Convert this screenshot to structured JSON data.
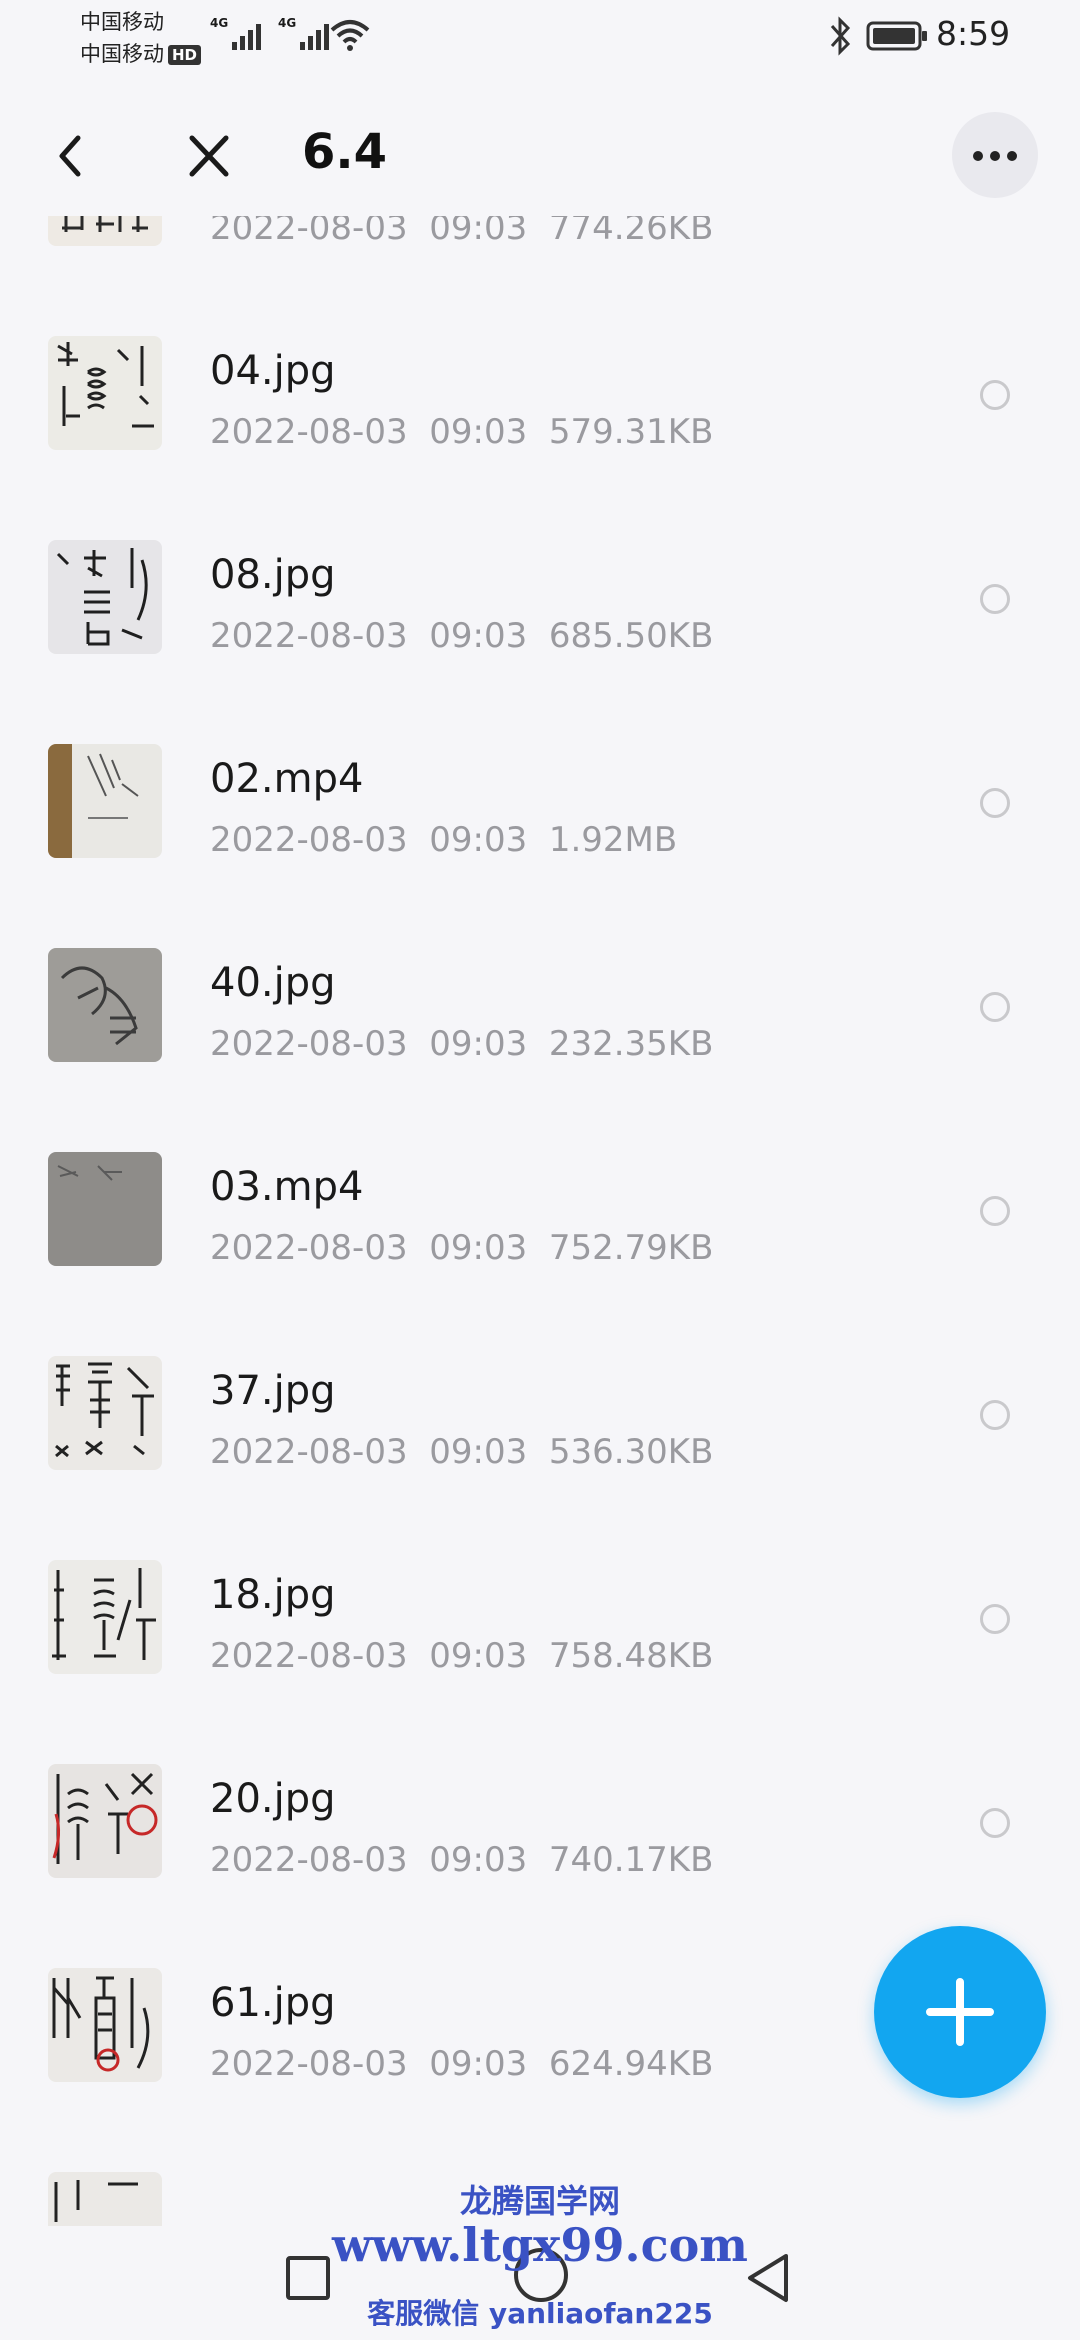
{
  "status_bar": {
    "carrier_1": "中国移动",
    "carrier_2": "中国移动",
    "hd_badge": "HD",
    "network_1": "4G",
    "network_2": "4G",
    "time": "8:59"
  },
  "header": {
    "title": "6.4",
    "back_icon": "chevron-left",
    "close_icon": "close-x",
    "more_icon": "more-horizontal"
  },
  "files": [
    {
      "name": "",
      "date": "2022-08-03",
      "time": "09:03",
      "size": "774.26KB",
      "thumb": "handwritten-page"
    },
    {
      "name": "04.jpg",
      "date": "2022-08-03",
      "time": "09:03",
      "size": "579.31KB",
      "thumb": "handwritten-page"
    },
    {
      "name": "08.jpg",
      "date": "2022-08-03",
      "time": "09:03",
      "size": "685.50KB",
      "thumb": "handwritten-page"
    },
    {
      "name": "02.mp4",
      "date": "2022-08-03",
      "time": "09:03",
      "size": "1.92MB",
      "thumb": "video-paper-desk"
    },
    {
      "name": "40.jpg",
      "date": "2022-08-03",
      "time": "09:03",
      "size": "232.35KB",
      "thumb": "gray-paper-sketch"
    },
    {
      "name": "03.mp4",
      "date": "2022-08-03",
      "time": "09:03",
      "size": "752.79KB",
      "thumb": "gray-paper-sketch"
    },
    {
      "name": "37.jpg",
      "date": "2022-08-03",
      "time": "09:03",
      "size": "536.30KB",
      "thumb": "handwritten-page"
    },
    {
      "name": "18.jpg",
      "date": "2022-08-03",
      "time": "09:03",
      "size": "758.48KB",
      "thumb": "handwritten-page"
    },
    {
      "name": "20.jpg",
      "date": "2022-08-03",
      "time": "09:03",
      "size": "740.17KB",
      "thumb": "handwritten-page-red"
    },
    {
      "name": "61.jpg",
      "date": "2022-08-03",
      "time": "09:03",
      "size": "624.94KB",
      "thumb": "handwritten-page-red"
    }
  ],
  "fab": {
    "icon": "plus"
  },
  "nav_bar": {
    "recents_icon": "square",
    "home_icon": "circle",
    "back_icon": "triangle-left"
  },
  "watermark": {
    "line1": "龙腾国学网",
    "line2": "www.ltgx99.com",
    "line3": "客服微信 yanliaofan225"
  },
  "colors": {
    "background": "#f6f6f9",
    "accent": "#12a6f0",
    "meta_text": "#9a9a9f",
    "watermark": "#3a52c4"
  }
}
